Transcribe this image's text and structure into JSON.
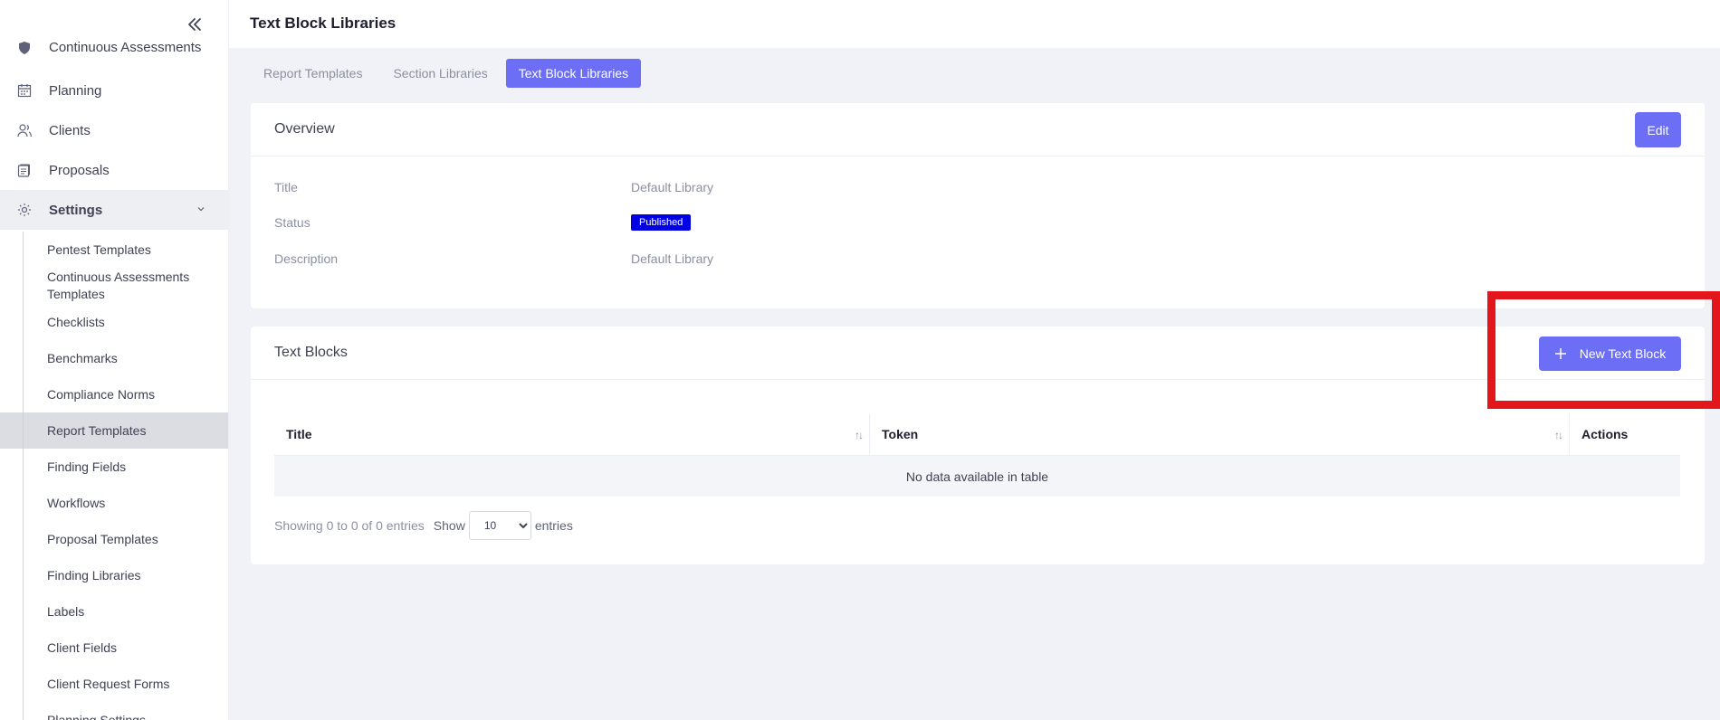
{
  "header": {
    "title": "Text Block Libraries"
  },
  "sidebar": {
    "items": [
      {
        "label": "Continuous Assessments",
        "icon": "shield-icon"
      },
      {
        "label": "Planning",
        "icon": "calendar-icon"
      },
      {
        "label": "Clients",
        "icon": "users-icon"
      },
      {
        "label": "Proposals",
        "icon": "document-stack-icon"
      },
      {
        "label": "Settings",
        "icon": "gear-icon"
      }
    ],
    "settings_sub": [
      "Pentest Templates",
      "Continuous Assessments Templates",
      "Checklists",
      "Benchmarks",
      "Compliance Norms",
      "Report Templates",
      "Finding Fields",
      "Workflows",
      "Proposal Templates",
      "Finding Libraries",
      "Labels",
      "Client Fields",
      "Client Request Forms",
      "Planning Settings"
    ]
  },
  "tabs": [
    "Report Templates",
    "Section Libraries",
    "Text Block Libraries"
  ],
  "overview": {
    "heading": "Overview",
    "edit_label": "Edit",
    "rows": [
      {
        "label": "Title",
        "value": "Default Library"
      },
      {
        "label": "Status",
        "value": "Published"
      },
      {
        "label": "Description",
        "value": "Default Library"
      }
    ]
  },
  "text_blocks": {
    "heading": "Text Blocks",
    "new_button": "New Text Block",
    "columns": [
      "Title",
      "Token",
      "Actions"
    ],
    "empty_message": "No data available in table",
    "footer": {
      "info": "Showing 0 to 0 of 0 entries",
      "show_label": "Show",
      "page_size": "10",
      "entries_label": "entries"
    }
  },
  "colors": {
    "accent": "#6c6ef5",
    "badge": "#0000e5",
    "highlight": "#e3161b"
  }
}
